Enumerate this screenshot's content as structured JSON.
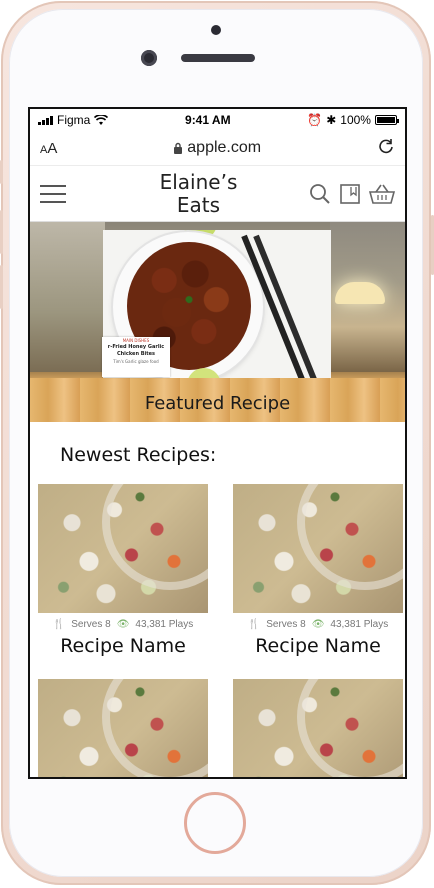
{
  "status_bar": {
    "carrier": "Figma",
    "time": "9:41 AM",
    "battery": "100%"
  },
  "browser": {
    "text_size_label": "AA",
    "url": "apple.com"
  },
  "site": {
    "title_line1": "Elaine’s",
    "title_line2": "Eats"
  },
  "icons": {
    "menu": "hamburger-icon",
    "search": "search-icon",
    "bookmark": "bookmark-icon",
    "basket": "basket-icon",
    "reload": "reload-icon",
    "lock": "lock-icon"
  },
  "hero": {
    "card_kicker": "MAIN DISHES",
    "card_title": "r-Fried Honey Garlic Chicken Bites",
    "card_sub": "Tim's Garlic glaze food",
    "label": "Featured Recipe"
  },
  "newest": {
    "title": "Newest Recipes:",
    "recipes": [
      {
        "serves": "Serves 8",
        "plays": "43,381 Plays",
        "name": "Recipe Name"
      },
      {
        "serves": "Serves 8",
        "plays": "43,381 Plays",
        "name": "Recipe Name"
      },
      {
        "serves": "",
        "plays": "",
        "name": ""
      },
      {
        "serves": "",
        "plays": "",
        "name": ""
      }
    ]
  },
  "colors": {
    "accent_green": "#7bb36a",
    "phone_frame": "#f2ddd4",
    "home_ring": "#e3a99a"
  }
}
